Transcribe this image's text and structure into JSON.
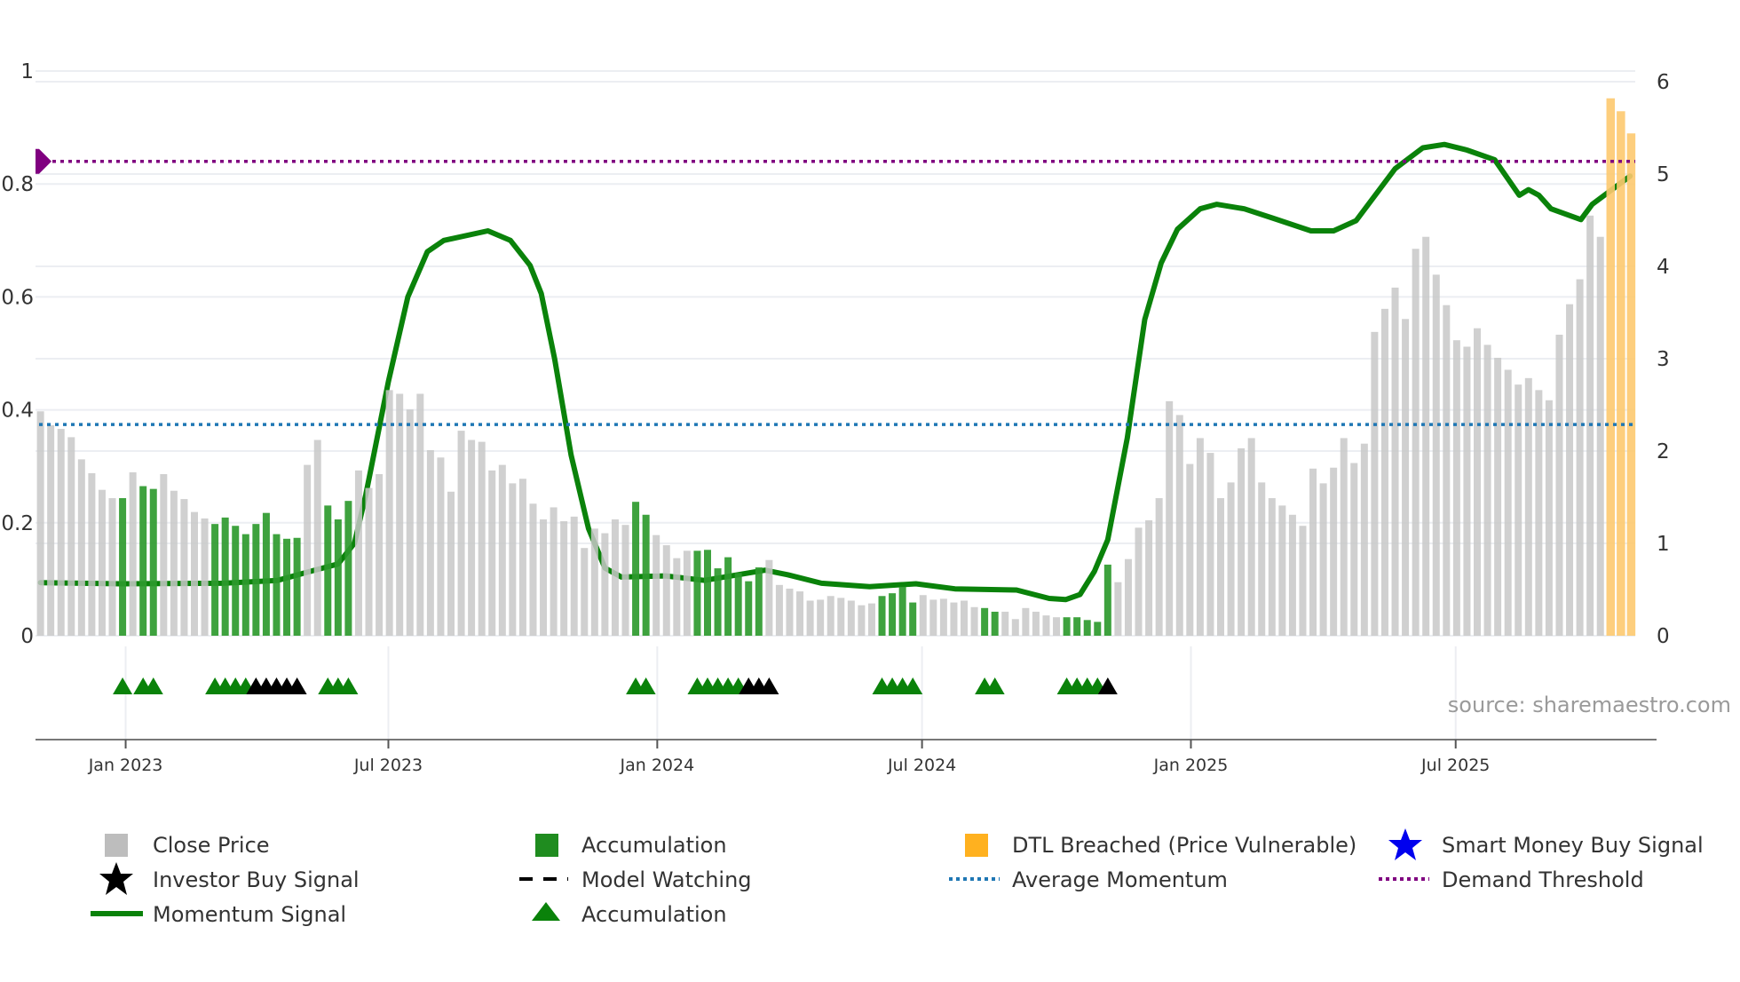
{
  "chart_data": {
    "type": "bar",
    "title": "",
    "xlabel": "",
    "ylabel_left": "",
    "ylabel_right": "",
    "ylim_left": [
      0,
      1
    ],
    "ylim_right": [
      0,
      6
    ],
    "yticks_left": [
      "0",
      "0.2",
      "0.4",
      "0.6",
      "0.8",
      "1"
    ],
    "yticks_right": [
      "0",
      "1",
      "2",
      "3",
      "4",
      "5",
      "6"
    ],
    "x_ticks": [
      {
        "x": 8.3,
        "label": "Jan 2023"
      },
      {
        "x": 33.9,
        "label": "Jul 2023"
      },
      {
        "x": 60.1,
        "label": "Jan 2024"
      },
      {
        "x": 85.9,
        "label": "Jul 2024"
      },
      {
        "x": 112.1,
        "label": "Jan 2025"
      },
      {
        "x": 137.9,
        "label": "Jul 2025"
      }
    ],
    "x_range": [
      0,
      155
    ],
    "grid": true,
    "close_price": [
      2.43,
      2.28,
      2.24,
      2.15,
      1.91,
      1.76,
      1.58,
      1.49,
      1.49,
      1.77,
      1.62,
      1.59,
      1.75,
      1.57,
      1.48,
      1.34,
      1.27,
      1.21,
      1.28,
      1.19,
      1.1,
      1.21,
      1.33,
      1.1,
      1.05,
      1.06,
      1.85,
      2.12,
      1.41,
      1.26,
      1.46,
      1.79,
      1.6,
      1.75,
      2.66,
      2.62,
      2.45,
      2.62,
      2.01,
      1.93,
      1.56,
      2.22,
      2.12,
      2.1,
      1.79,
      1.85,
      1.65,
      1.7,
      1.43,
      1.26,
      1.39,
      1.24,
      1.29,
      0.95,
      1.16,
      1.11,
      1.26,
      1.2,
      1.45,
      1.31,
      1.09,
      0.98,
      0.84,
      0.92,
      0.92,
      0.93,
      0.73,
      0.85,
      0.68,
      0.59,
      0.74,
      0.82,
      0.55,
      0.51,
      0.48,
      0.38,
      0.39,
      0.43,
      0.41,
      0.38,
      0.33,
      0.35,
      0.43,
      0.46,
      0.53,
      0.36,
      0.44,
      0.39,
      0.4,
      0.36,
      0.38,
      0.31,
      0.3,
      0.26,
      0.26,
      0.18,
      0.3,
      0.26,
      0.22,
      0.2,
      0.2,
      0.2,
      0.17,
      0.15,
      0.77,
      0.58,
      0.83,
      1.17,
      1.25,
      1.49,
      2.54,
      2.39,
      1.86,
      2.14,
      1.98,
      1.49,
      1.66,
      2.03,
      2.14,
      1.66,
      1.49,
      1.41,
      1.31,
      1.19,
      1.81,
      1.65,
      1.82,
      2.14,
      1.87,
      2.08,
      3.29,
      3.54,
      3.77,
      3.43,
      4.19,
      4.32,
      3.91,
      3.58,
      3.2,
      3.13,
      3.33,
      3.15,
      3.01,
      2.88,
      2.72,
      2.79,
      2.66,
      2.55,
      3.26,
      3.59,
      3.86,
      4.55,
      4.32,
      5.82,
      5.68,
      5.44
    ],
    "accumulation_bar_indices": [
      8,
      10,
      11,
      17,
      18,
      19,
      20,
      21,
      22,
      23,
      24,
      25,
      28,
      29,
      30,
      58,
      59,
      64,
      65,
      66,
      67,
      68,
      69,
      70,
      82,
      83,
      84,
      85,
      92,
      93,
      100,
      101,
      102,
      103,
      104
    ],
    "dtl_breached_indices": [
      153,
      154,
      155
    ],
    "momentum_signal": [
      [
        0,
        0.094
      ],
      [
        7.9,
        0.092
      ],
      [
        17.7,
        0.093
      ],
      [
        23.1,
        0.098
      ],
      [
        26.3,
        0.114
      ],
      [
        29,
        0.127
      ],
      [
        30.6,
        0.164
      ],
      [
        31.7,
        0.25
      ],
      [
        33.9,
        0.45
      ],
      [
        35.8,
        0.6
      ],
      [
        37.7,
        0.68
      ],
      [
        39.3,
        0.7
      ],
      [
        43.6,
        0.717
      ],
      [
        45.8,
        0.7
      ],
      [
        47.7,
        0.656
      ],
      [
        48.8,
        0.606
      ],
      [
        50.1,
        0.49
      ],
      [
        51.7,
        0.32
      ],
      [
        53.4,
        0.19
      ],
      [
        55,
        0.12
      ],
      [
        56.6,
        0.104
      ],
      [
        60.9,
        0.106
      ],
      [
        64.7,
        0.098
      ],
      [
        70.6,
        0.116
      ],
      [
        72.8,
        0.108
      ],
      [
        76.1,
        0.093
      ],
      [
        80.8,
        0.087
      ],
      [
        85.3,
        0.092
      ],
      [
        89.1,
        0.083
      ],
      [
        95.1,
        0.081
      ],
      [
        98.3,
        0.066
      ],
      [
        99.9,
        0.064
      ],
      [
        101.3,
        0.073
      ],
      [
        102.7,
        0.114
      ],
      [
        104,
        0.17
      ],
      [
        105.9,
        0.35
      ],
      [
        107.6,
        0.56
      ],
      [
        109.2,
        0.66
      ],
      [
        110.8,
        0.72
      ],
      [
        113,
        0.756
      ],
      [
        114.6,
        0.764
      ],
      [
        117.3,
        0.756
      ],
      [
        120,
        0.74
      ],
      [
        123.8,
        0.717
      ],
      [
        126,
        0.717
      ],
      [
        128.2,
        0.735
      ],
      [
        132,
        0.827
      ],
      [
        134.7,
        0.864
      ],
      [
        136.8,
        0.87
      ],
      [
        139,
        0.86
      ],
      [
        141.7,
        0.843
      ],
      [
        144.1,
        0.78
      ],
      [
        145,
        0.79
      ],
      [
        146,
        0.78
      ],
      [
        147.2,
        0.756
      ],
      [
        150.1,
        0.737
      ],
      [
        151.2,
        0.764
      ],
      [
        154.9,
        0.814
      ]
    ],
    "average_momentum": 0.374,
    "demand_threshold": 0.84,
    "accumulation_markers": [
      8,
      10,
      11,
      17,
      18,
      19,
      20,
      28,
      29,
      30,
      58,
      59,
      64,
      65,
      66,
      67,
      68,
      82,
      83,
      84,
      85,
      92,
      93,
      100,
      101,
      102,
      103
    ],
    "model_watching_markers": [
      21,
      22,
      23,
      24,
      25,
      69,
      70,
      71,
      104
    ],
    "colors": {
      "close_price": "#c8c8c8",
      "accumulation": "#2e9a2e",
      "dtl_breached": "#fdc96f",
      "dtl_legend": "#ffb11f",
      "momentum": "#0a820a",
      "average_momentum": "#1f77b4",
      "demand_threshold": "#800080",
      "marker_accumulation": "#0a820a",
      "marker_watching": "#000000",
      "smart_money": "#0000ee"
    },
    "legend": {
      "placement": "bottom",
      "items": [
        {
          "label": "Close Price",
          "icon": "gray-square"
        },
        {
          "label": "Accumulation",
          "icon": "green-square"
        },
        {
          "label": "DTL Breached (Price Vulnerable)",
          "icon": "orange-square"
        },
        {
          "label": "Smart Money Buy Signal",
          "icon": "blue-star"
        },
        {
          "label": "Investor Buy Signal",
          "icon": "black-star"
        },
        {
          "label": "Model Watching",
          "icon": "black-dashed-line"
        },
        {
          "label": "Average Momentum",
          "icon": "blue-dotted-line"
        },
        {
          "label": "Demand Threshold",
          "icon": "purple-dotted-line"
        },
        {
          "label": "Momentum Signal",
          "icon": "green-line"
        },
        {
          "label": "Accumulation",
          "icon": "green-triangle"
        }
      ]
    },
    "source": "source: sharemaestro.com"
  }
}
